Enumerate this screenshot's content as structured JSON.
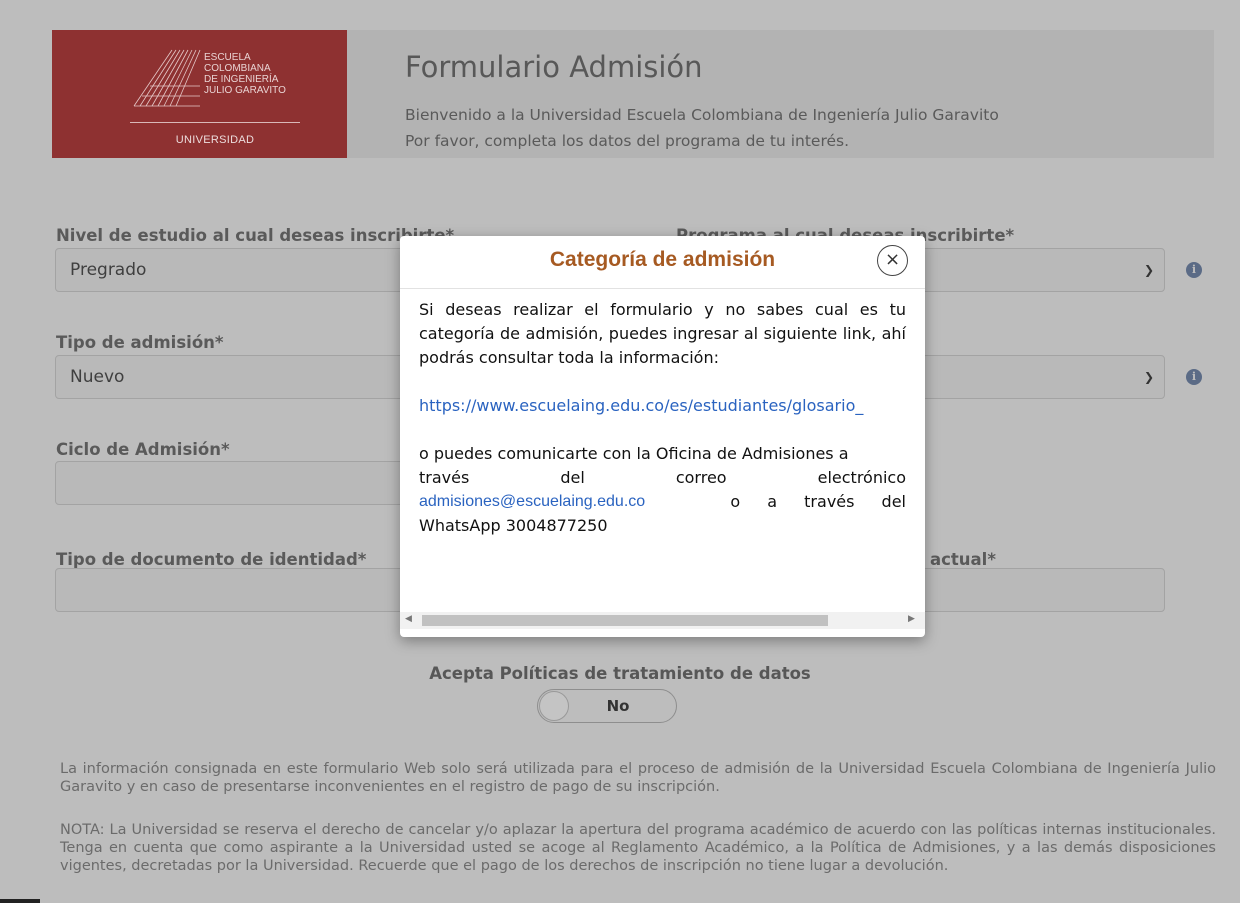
{
  "header": {
    "logo": {
      "line1": "ESCUELA",
      "line2": "COLOMBIANA",
      "line3": "DE INGENIERÍA",
      "line4": "JULIO GARAVITO",
      "bottom": "UNIVERSIDAD"
    },
    "title": "Formulario Admisión",
    "subtitle_line1": "Bienvenido a la Universidad Escuela Colombiana de Ingeniería Julio Garavito",
    "subtitle_line2": "Por favor, completa los datos del programa de tu interés."
  },
  "form": {
    "nivel_label": "Nivel de estudio al cual deseas inscribirte*",
    "nivel_value": "Pregrado",
    "programa_label": "Programa al cual deseas inscribirte*",
    "tipo_admision_label": "Tipo de admisión*",
    "tipo_admision_value": "Nuevo",
    "ciclo_label": "Ciclo de Admisión*",
    "tipo_doc_label": "Tipo de documento de identidad*",
    "actual_label": "actual*",
    "consent_label": "Acepta Políticas de tratamiento de datos",
    "consent_value": "No"
  },
  "disclaimer": {
    "p1": "La información consignada en este formulario Web solo será utilizada para el proceso de admisión de la Universidad Escuela Colombiana de Ingeniería Julio Garavito y en caso de presentarse inconvenientes en el registro de pago de su inscripción.",
    "p2": "NOTA: La Universidad se reserva el derecho de cancelar y/o aplazar la apertura del programa académico de acuerdo con las políticas internas institucionales. Tenga en cuenta que como aspirante a la Universidad usted se acoge al Reglamento Académico, a la Política de Admisiones, y a las demás disposiciones vigentes, decretadas por la Universidad. Recuerde que el pago de los derechos de inscripción no tiene lugar a devolución."
  },
  "modal": {
    "title": "Categoría de admisión",
    "close_symbol": "×",
    "intro": "Si deseas realizar el formulario y no sabes cual es  tu categoría de admisión, puedes ingresar al siguiente link, ahí podrás consultar toda la información:",
    "link": "https://www.escuelaing.edu.co/es/estudiantes/glosario_",
    "contact_lines": {
      "l1": "o puedes comunicarte con la Oficina de Admisiones a",
      "l2": "través del correo electrónico",
      "email": "admisiones@escuelaing.edu.co",
      "l3_tail": "o a través del",
      "l4": "WhatsApp 3004877250"
    }
  },
  "icons": {
    "select_chevron": "chevron-down-icon",
    "info": "info-icon",
    "close": "close-icon",
    "scroll_left": "scroll-left-icon",
    "scroll_right": "scroll-right-icon"
  },
  "colors": {
    "logo_bg": "#8e3131",
    "modal_title": "#a65a22",
    "link": "#2a63c0",
    "overlay_bg": "#bdbdbd"
  }
}
